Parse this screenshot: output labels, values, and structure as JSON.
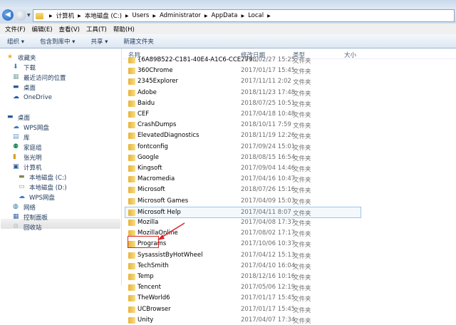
{
  "address": {
    "crumbs": [
      "计算机",
      "本地磁盘 (C:)",
      "Users",
      "Administrator",
      "AppData",
      "Local"
    ]
  },
  "menu": [
    "文件(F)",
    "编辑(E)",
    "查看(V)",
    "工具(T)",
    "帮助(H)"
  ],
  "toolbar": {
    "organize": "组织 ▾",
    "include": "包含到库中 ▾",
    "share": "共享 ▾",
    "new_folder": "新建文件夹"
  },
  "sidebar": {
    "favorites": "收藏夹",
    "fav_items": [
      "下载",
      "最近访问的位置",
      "桌面",
      "OneDrive"
    ],
    "desktop": "桌面",
    "desk_items": [
      "WPS网盘",
      "库",
      "家庭组",
      "张光明",
      "计算机"
    ],
    "computer_items": [
      "本地磁盘 (C:)",
      "本地磁盘 (D:)",
      "WPS网盘"
    ],
    "more": [
      "网络",
      "控制面板",
      "回收站"
    ]
  },
  "columns": {
    "name": "名称",
    "date": "修改日期",
    "type": "类型",
    "size": "大小"
  },
  "files": [
    {
      "name": "{6A89B522-C181-40E4-A1C6-CCE779...",
      "date": "2018/02/27 15:25",
      "type": "文件夹"
    },
    {
      "name": "360Chrome",
      "date": "2017/01/17 15:45",
      "type": "文件夹"
    },
    {
      "name": "2345Explorer",
      "date": "2017/11/11 2:02",
      "type": "文件夹"
    },
    {
      "name": "Adobe",
      "date": "2018/11/23 17:48",
      "type": "文件夹"
    },
    {
      "name": "Baidu",
      "date": "2018/07/25 10:51",
      "type": "文件夹"
    },
    {
      "name": "CEF",
      "date": "2017/04/18 10:48",
      "type": "文件夹"
    },
    {
      "name": "CrashDumps",
      "date": "2018/10/11 7:59",
      "type": "文件夹"
    },
    {
      "name": "ElevatedDiagnostics",
      "date": "2018/11/19 12:26",
      "type": "文件夹"
    },
    {
      "name": "fontconfig",
      "date": "2017/09/24 15:01",
      "type": "文件夹"
    },
    {
      "name": "Google",
      "date": "2018/08/15 16:54",
      "type": "文件夹"
    },
    {
      "name": "Kingsoft",
      "date": "2017/09/04 14:46",
      "type": "文件夹"
    },
    {
      "name": "Macromedia",
      "date": "2017/04/16 10:47",
      "type": "文件夹"
    },
    {
      "name": "Microsoft",
      "date": "2018/07/26 15:16",
      "type": "文件夹"
    },
    {
      "name": "Microsoft Games",
      "date": "2017/04/09 15:03",
      "type": "文件夹"
    },
    {
      "name": "Microsoft Help",
      "date": "2017/04/11 8:07",
      "type": "文件夹"
    },
    {
      "name": "Mozilla",
      "date": "2017/04/08 17:37",
      "type": "文件夹"
    },
    {
      "name": "MozillaOnline",
      "date": "2017/08/02 17:17",
      "type": "文件夹"
    },
    {
      "name": "Programs",
      "date": "2017/10/06 10:37",
      "type": "文件夹"
    },
    {
      "name": "SysassistByHotWheel",
      "date": "2017/04/12 15:13",
      "type": "文件夹"
    },
    {
      "name": "TechSmith",
      "date": "2017/04/10 16:04",
      "type": "文件夹"
    },
    {
      "name": "Temp",
      "date": "2018/12/16 10:16",
      "type": "文件夹"
    },
    {
      "name": "Tencent",
      "date": "2017/05/06 12:19",
      "type": "文件夹"
    },
    {
      "name": "TheWorld6",
      "date": "2017/01/17 15:45",
      "type": "文件夹"
    },
    {
      "name": "UCBrowser",
      "date": "2017/01/17 15:45",
      "type": "文件夹"
    },
    {
      "name": "Unity",
      "date": "2017/04/07 17:34",
      "type": "文件夹"
    }
  ],
  "hover_index": 14,
  "highlight_index": 20
}
